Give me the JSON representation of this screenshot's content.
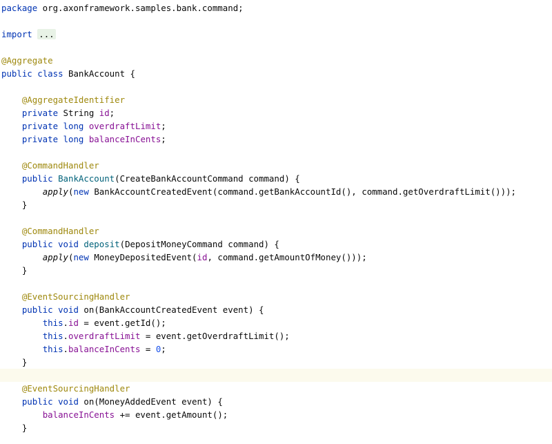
{
  "code": {
    "package_kw": "package",
    "package_name": " org.axonframework.samples.bank.command;",
    "import_kw": "import",
    "import_folded": "...",
    "ann_aggregate": "@Aggregate",
    "public_kw": "public",
    "class_kw": "class",
    "class_name": " BankAccount {",
    "ann_aggregate_identifier": "@AggregateIdentifier",
    "private_kw": "private",
    "string_type": " String ",
    "field_id": "id",
    "long_kw": "long",
    "field_overdraft": "overdraftLimit",
    "field_balance": "balanceInCents",
    "semicolon": ";",
    "ann_command_handler": "@CommandHandler",
    "ctor_name": "BankAccount",
    "ctor_params": "(CreateBankAccountCommand command) {",
    "apply_fn": "apply",
    "new_kw": "new",
    "ctor_body_rest": " BankAccountCreatedEvent(command.getBankAccountId(), command.getOverdraftLimit()));",
    "close_brace": "}",
    "void_kw": "void",
    "deposit_name": "deposit",
    "deposit_params": "(DepositMoneyCommand command) {",
    "deposit_body_mid": " MoneyDepositedEvent(",
    "deposit_body_rest": ", command.getAmountOfMoney()));",
    "ann_event_sourcing": "@EventSourcingHandler",
    "on_params_created": " on(BankAccountCreatedEvent event) {",
    "this_kw": "this",
    "assign_id_rest": " = event.getId();",
    "assign_overdraft_rest": " = event.getOverdraftLimit();",
    "assign_balance_eq": " = ",
    "zero": "0",
    "on_params_added": " on(MoneyAddedEvent event) {",
    "balance_add_rest": " += event.getAmount();",
    "paren_open": "(",
    "space": " "
  }
}
